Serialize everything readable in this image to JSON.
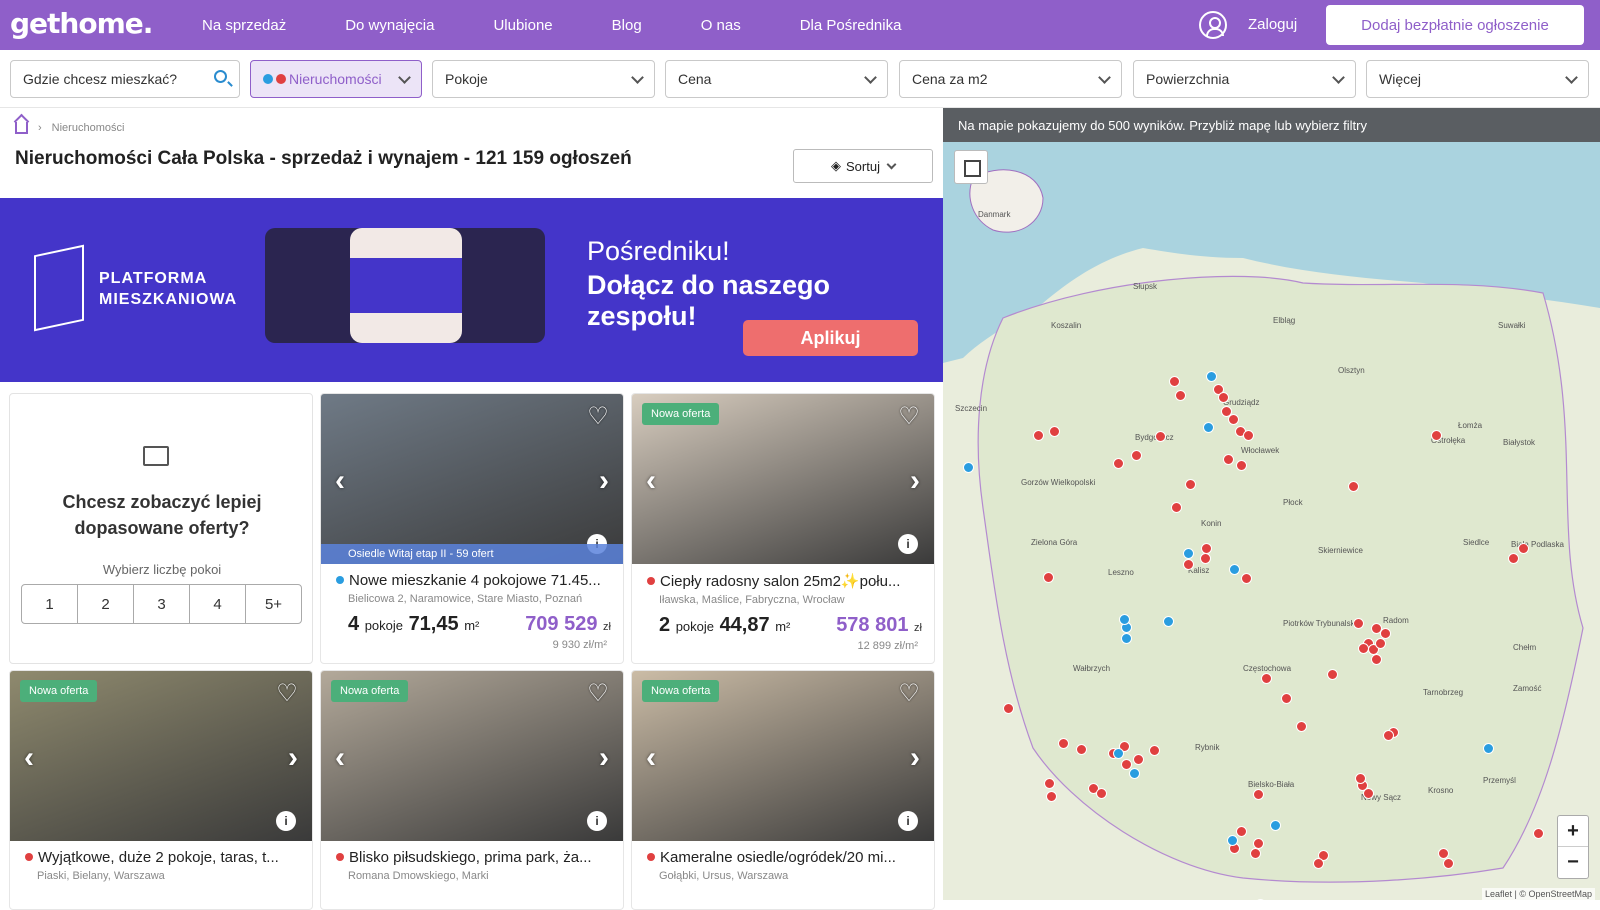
{
  "header": {
    "logo": "gethome.",
    "nav": [
      "Na sprzedaż",
      "Do wynajęcia",
      "Ulubione",
      "Blog",
      "O nas",
      "Dla Pośrednika"
    ],
    "login": "Zaloguj",
    "add_button": "Dodaj bezpłatnie ogłoszenie"
  },
  "filters": {
    "search_placeholder": "Gdzie chcesz mieszkać?",
    "property": "Nieruchomości",
    "rooms": "Pokoje",
    "price": "Cena",
    "price_m2": "Cena za m2",
    "area": "Powierzchnia",
    "more": "Więcej"
  },
  "breadcrumb": {
    "item": "Nieruchomości"
  },
  "page_title": "Nieruchomości Cała Polska - sprzedaż i wynajem - 121 159 ogłoszeń",
  "sort_label": "Sortuj",
  "banner": {
    "brand_line1": "PLATFORMA",
    "brand_line2": "MIESZKANIOWA",
    "headline1": "Pośredniku!",
    "headline2": "Dołącz do naszego zespołu!",
    "cta": "Aplikuj"
  },
  "promo": {
    "title": "Chcesz zobaczyć lepiej dopasowane oferty?",
    "subtitle": "Wybierz liczbę pokoi",
    "options": [
      "1",
      "2",
      "3",
      "4",
      "5+"
    ]
  },
  "listings": [
    {
      "badge": "",
      "dev": "Osiedle Witaj etap II - 59 ofert",
      "dot": "#2a9de0",
      "title": "Nowe mieszkanie 4 pokojowe 71.45...",
      "address": "Bielicowa 2, Naramowice, Stare Miasto, Poznań",
      "rooms": "4",
      "rooms_label": "pokoje",
      "area": "71,45",
      "area_unit": "m²",
      "price": "709 529",
      "currency": "zł",
      "price_m2": "9 930 zł/m²",
      "photo": "#6f7a86"
    },
    {
      "badge": "Nowa oferta",
      "dev": "",
      "dot": "#e04040",
      "title": "Ciepły radosny salon 25m2✨połu...",
      "address": "Iławska, Maślice, Fabryczna, Wrocław",
      "rooms": "2",
      "rooms_label": "pokoje",
      "area": "44,87",
      "area_unit": "m²",
      "price": "578 801",
      "currency": "zł",
      "price_m2": "12 899 zł/m²",
      "photo": "#d8cdbf"
    },
    {
      "badge": "Nowa oferta",
      "dev": "",
      "dot": "#e04040",
      "title": "Wyjątkowe, duże 2 pokoje, taras, t...",
      "address": "Piaski, Bielany, Warszawa",
      "photo": "#8f8a6e"
    },
    {
      "badge": "Nowa oferta",
      "dev": "",
      "dot": "#e04040",
      "title": "Blisko piłsudskiego, prima park, ża...",
      "address": "Romana Dmowskiego, Marki",
      "photo": "#b3a99a"
    },
    {
      "badge": "Nowa oferta",
      "dev": "",
      "dot": "#e04040",
      "title": "Kameralne osiedle/ogródek/20 mi...",
      "address": "Gołąbki, Ursus, Warszawa",
      "photo": "#cbbca6"
    }
  ],
  "map": {
    "notice": "Na mapie pokazujemy do 500 wyników. Przybliż mapę lub wybierz filtry",
    "zoom_in": "+",
    "zoom_out": "−",
    "attribution": "Leaflet | © OpenStreetMap",
    "labels": [
      "Danmark",
      "Słupsk",
      "Koszalin",
      "Szczecin",
      "Bydgoszcz",
      "Grudziądz",
      "Elbląg",
      "Olsztyn",
      "Suwałki",
      "Łomża",
      "Białystok",
      "Płock",
      "Konin",
      "Włocławek",
      "Kalisz",
      "Leszno",
      "Zielona Góra",
      "Gorzów Wielkopolski",
      "Siedlce",
      "Biała Podlaska",
      "Chełm",
      "Zamość",
      "Tarnobrzeg",
      "Krosno",
      "Przemyśl",
      "Nowy Sącz",
      "Rybnik",
      "Bielsko-Biała",
      "Wałbrzych",
      "Częstochowa",
      "Piotrków Trybunalski",
      "Skierniewice",
      "Ostrołęka",
      "Radom"
    ]
  },
  "colors": {
    "brand": "#8f5fc9",
    "marker_red": "#e04040",
    "marker_blue": "#2a9de0",
    "banner": "#4435c9",
    "cta": "#ee6e6e"
  }
}
